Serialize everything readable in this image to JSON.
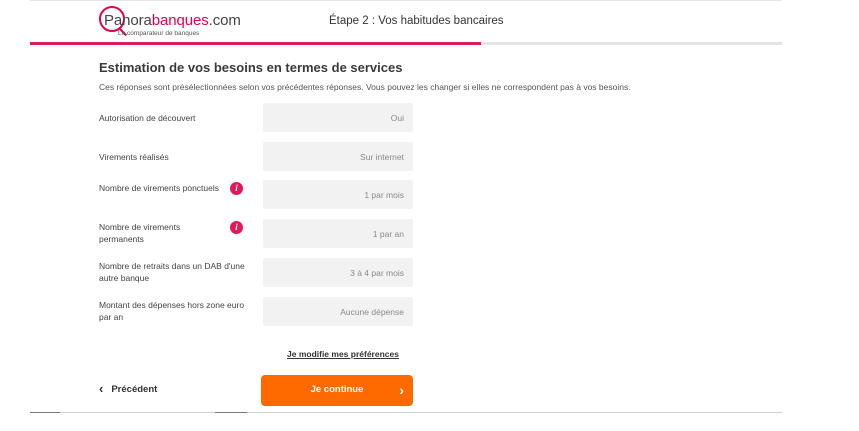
{
  "header": {
    "logo": {
      "name_part1": "P",
      "name_part2": "anora",
      "name_part3": "banques",
      "name_part4": ".com",
      "tagline": "Le comparateur de banques"
    },
    "step_title": "Étape 2 : Vos habitudes bancaires",
    "progress": 0.6,
    "colors": {
      "brand": "#e8004c",
      "progress": "#e2185a",
      "cta": "#ff6a00"
    }
  },
  "section": {
    "title": "Estimation de vos besoins en termes de services",
    "subtitle": "Ces réponses sont présélectionnées selon vos précédentes réponses. Vous pouvez les changer si elles ne correspondent pas à vos besoins."
  },
  "rows": [
    {
      "label": "Autorisation de découvert",
      "value": "Oui",
      "info": false
    },
    {
      "label": "Virements réalisés",
      "value": "Sur internet",
      "info": false
    },
    {
      "label": "Nombre de virements ponctuels",
      "value": "1 par mois",
      "info": true,
      "info_icon": "i"
    },
    {
      "label": "Nombre de virements permanents",
      "value": "1 par an",
      "info": true,
      "info_icon": "i"
    },
    {
      "label": "Nombre de retraits dans un DAB d'une autre banque",
      "value": "3 à 4 par mois",
      "info": false
    },
    {
      "label": "Montant des dépenses hors zone euro par an",
      "value": "Aucune dépense",
      "info": false
    }
  ],
  "actions": {
    "modify_link": "Je modifie mes préférences",
    "previous_label": "Précédent",
    "previous_icon": "‹",
    "continue_label": "Je continue",
    "continue_icon": "›"
  }
}
